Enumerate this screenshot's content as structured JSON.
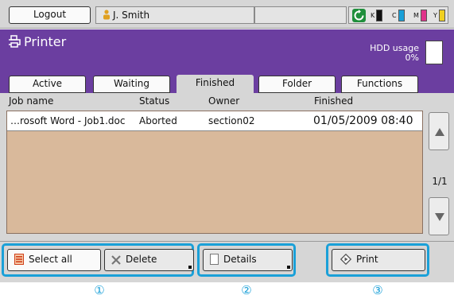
{
  "topbar": {
    "logout_label": "Logout",
    "user_name": "J. Smith",
    "ink": [
      {
        "label": "K",
        "color": "#111111"
      },
      {
        "label": "C",
        "color": "#1aa0d8"
      },
      {
        "label": "M",
        "color": "#e0338a"
      },
      {
        "label": "Y",
        "color": "#f0d020"
      }
    ]
  },
  "header": {
    "title": "Printer",
    "hdd_label": "HDD usage",
    "hdd_value": "0%",
    "accent": "#6b3ea0"
  },
  "tabs": [
    {
      "label": "Active"
    },
    {
      "label": "Waiting"
    },
    {
      "label": "Finished",
      "selected": true
    },
    {
      "label": "Folder"
    },
    {
      "label": "Functions"
    }
  ],
  "list": {
    "columns": [
      "Job name",
      "Status",
      "Owner",
      "Finished"
    ],
    "rows": [
      {
        "job_name": "…rosoft Word - Job1.doc",
        "status": "Aborted",
        "owner": "section02",
        "finished": "01/05/2009 08:40"
      }
    ],
    "page": "1/1"
  },
  "actions": {
    "select_all": "Select all",
    "delete": "Delete",
    "details": "Details",
    "print": "Print",
    "highlight_color": "#1aa0d8"
  },
  "callouts": [
    "①",
    "②",
    "③"
  ]
}
